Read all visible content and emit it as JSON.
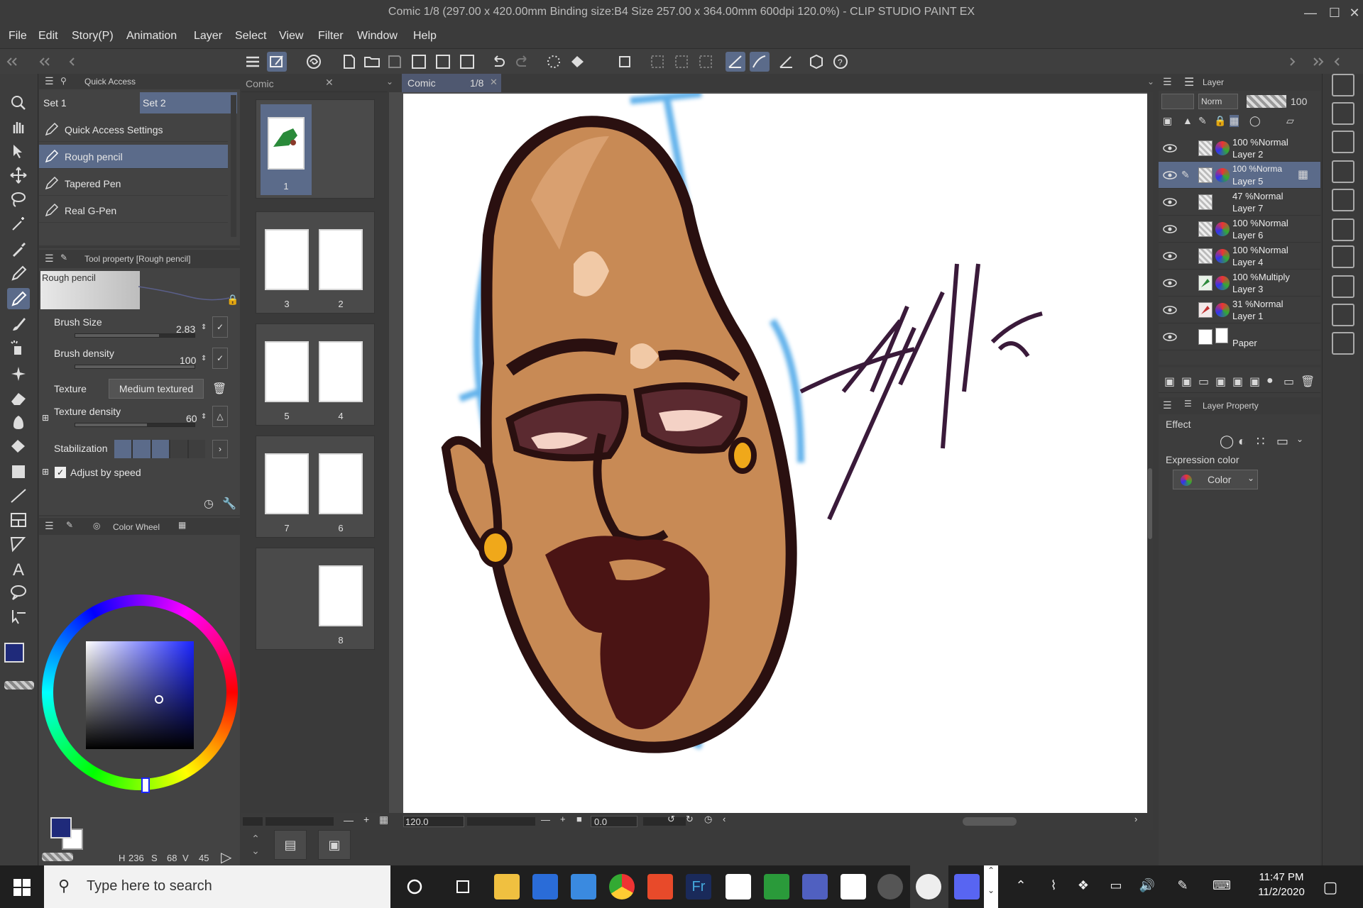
{
  "window": {
    "title": "Comic 1/8 (297.00 x 420.00mm Binding size:B4 Size 257.00 x 364.00mm 600dpi 120.0%) - CLIP STUDIO PAINT EX"
  },
  "menu": [
    "File",
    "Edit",
    "Story(P)",
    "Animation",
    "Layer",
    "Select",
    "View",
    "Filter",
    "Window",
    "Help"
  ],
  "quick_access": {
    "header": "Quick Access",
    "sets": [
      "Set 1",
      "Set 2"
    ],
    "items": [
      "Quick Access Settings",
      "Rough pencil",
      "Tapered Pen",
      "Real G-Pen"
    ]
  },
  "tool_property": {
    "header": "Tool property [Rough pencil]",
    "preview_label": "Rough pencil",
    "brush_size_label": "Brush Size",
    "brush_size_value": "2.83",
    "brush_density_label": "Brush density",
    "brush_density_value": "100",
    "texture_label": "Texture",
    "texture_value": "Medium textured",
    "texture_density_label": "Texture density",
    "texture_density_value": "60",
    "stabilization_label": "Stabilization",
    "adjust_by_speed_label": "Adjust by speed"
  },
  "color_wheel": {
    "header": "Color Wheel",
    "main_color": "#1f2a7a",
    "sub_color": "#ffffff",
    "hsv": {
      "h_label": "H",
      "h_value": "236",
      "s_label": "S",
      "s_value": "68",
      "v_label": "V",
      "v_value": "45"
    }
  },
  "page_manager": {
    "tab_label": "Comic",
    "pages": [
      "1",
      "3",
      "2",
      "5",
      "4",
      "7",
      "6",
      "8"
    ]
  },
  "canvas": {
    "tab_label": "Comic",
    "tab_page": "1/8",
    "zoom": "120.0",
    "rotation": "0.0"
  },
  "layer_panel": {
    "header": "Layer",
    "blend_mode": "Norm",
    "opacity": "100",
    "layers": [
      {
        "mode": "100 %Normal",
        "name": "Layer 2"
      },
      {
        "mode": "100 %Norma",
        "name": "Layer 5"
      },
      {
        "mode": "47 %Normal",
        "name": "Layer 7"
      },
      {
        "mode": "100 %Normal",
        "name": "Layer 6"
      },
      {
        "mode": "100 %Normal",
        "name": "Layer 4"
      },
      {
        "mode": "100 %Multiply",
        "name": "Layer 3"
      },
      {
        "mode": "31 %Normal",
        "name": "Layer 1"
      },
      {
        "mode": "",
        "name": "Paper"
      }
    ]
  },
  "layer_property": {
    "header": "Layer Property",
    "effect_label": "Effect",
    "expression_label": "Expression color",
    "expression_value": "Color"
  },
  "taskbar": {
    "search_placeholder": "Type here to search",
    "time": "11:47 PM",
    "date": "11/2/2020"
  },
  "colors": {
    "accent": "#5b6b8a",
    "panel_bg": "#434343",
    "taskbar_bg": "#1f1f1f"
  }
}
